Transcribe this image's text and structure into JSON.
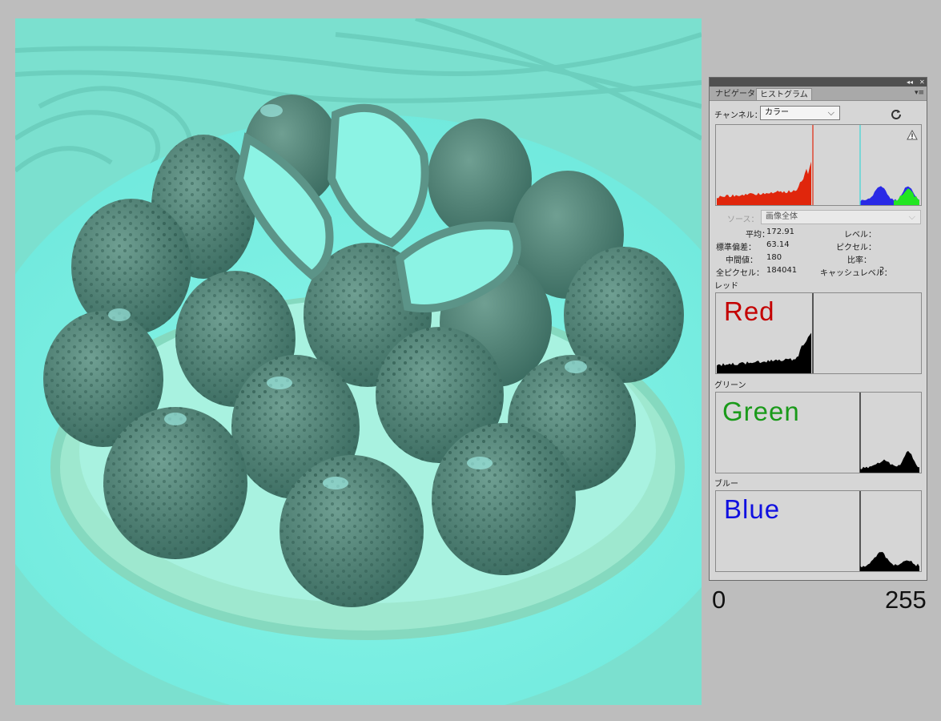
{
  "panel": {
    "tabs": [
      {
        "label": "ナビゲータ",
        "active": false
      },
      {
        "label": "ヒストグラム",
        "active": true
      }
    ],
    "channel_label": "チャンネル：",
    "channel_value": "カラー",
    "source_label": "ソース：",
    "source_value": "画像全体",
    "stats": {
      "mean_label": "平均：",
      "mean_value": "172.91",
      "stddev_label": "標準偏差：",
      "stddev_value": "63.14",
      "median_label": "中間値：",
      "median_value": "180",
      "pixels_label": "全ピクセル：",
      "pixels_value": "184041",
      "level_label": "レベル：",
      "count_label": "ピクセル：",
      "percentile_label": "比率：",
      "cache_label": "キャッシュレベル：",
      "cache_value": "2"
    },
    "channels": [
      {
        "heading": "レッド",
        "overlay": "Red",
        "color": "#c40000"
      },
      {
        "heading": "グリーン",
        "overlay": "Green",
        "color": "#1a9a1a"
      },
      {
        "heading": "ブルー",
        "overlay": "Blue",
        "color": "#1010e0"
      }
    ]
  },
  "scale": {
    "min": "0",
    "max": "255"
  },
  "colors": {
    "composite_red": "#e0260c",
    "composite_green": "#22e622",
    "composite_blue": "#2a2ae6",
    "composite_cyan": "#3cd6d6",
    "photo_tint": "#7ee8d6"
  },
  "icons": [
    "collapse-icon",
    "close-icon",
    "panel-menu-icon",
    "refresh-icon",
    "warning-icon",
    "chevron-down-icon"
  ]
}
